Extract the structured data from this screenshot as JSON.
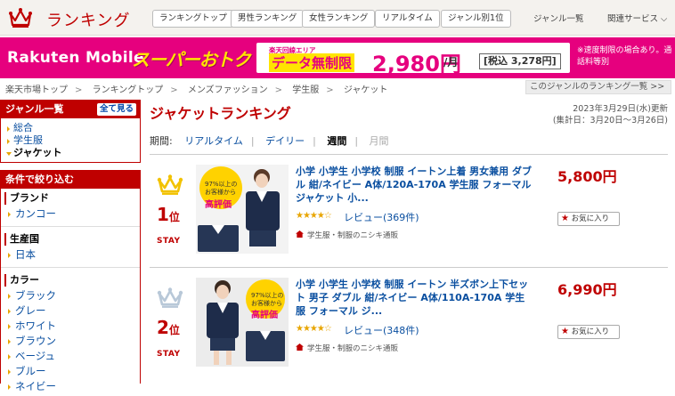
{
  "header": {
    "logo_text": "ランキング",
    "nav": [
      "ランキングトップ",
      "男性ランキング",
      "女性ランキング",
      "リアルタイム",
      "ジャンル別1位"
    ],
    "genre_list": "ジャンル一覧",
    "related": "関連サービス ⌵"
  },
  "banner": {
    "brand": "Rakuten Mobile",
    "super": "スーパーおトク",
    "small": "楽天回線エリア",
    "main": "データ無制限",
    "price": "2,980円",
    "unit": "/月",
    "tax": "[税込 3,278円]",
    "note": "※速度制限の場合あり。通話料等別",
    "bg": "#e6007e"
  },
  "breadcrumb": [
    "楽天市場トップ",
    "ランキングトップ",
    "メンズファッション",
    "学生服",
    "ジャケット"
  ],
  "genre_all_link": "このジャンルのランキング一覧 >>",
  "sidebar": {
    "genre_title": "ジャンル一覧",
    "see_all": "全て見る",
    "genres": [
      "総合",
      "学生服",
      "ジャケット"
    ],
    "filter_title": "条件で絞り込む",
    "groups": [
      {
        "title": "ブランド",
        "items": [
          "カンコー"
        ]
      },
      {
        "title": "生産国",
        "items": [
          "日本"
        ]
      },
      {
        "title": "カラー",
        "items": [
          "ブラック",
          "グレー",
          "ホワイト",
          "ブラウン",
          "ベージュ",
          "ブルー",
          "ネイビー"
        ]
      }
    ]
  },
  "main": {
    "title": "ジャケットランキング",
    "updated": "2023年3月29日(水)更新",
    "period_range": "(集計日：3月20日～3月26日)",
    "period_label": "期間:",
    "periods": [
      "リアルタイム",
      "デイリー",
      "週間",
      "月間"
    ]
  },
  "items": [
    {
      "rank": "1",
      "rank_suffix": "位",
      "stay": "STAY",
      "name": "小学 小学生 小学校 制服 イートン上着 男女兼用 ダブル 紺/ネイビー A体/120A-170A 学生服 フォーマル ジャケット 小...",
      "stars": "★★★★☆",
      "review": "レビュー(369件)",
      "shop": "学生服・制服のニシキ通販",
      "price": "5,800円",
      "fav": "お気に入り",
      "crown_color": "#f2c200",
      "thumb_badge_top": "97%以上の",
      "thumb_badge_mid": "お客様から",
      "thumb_badge_bot": "高評価"
    },
    {
      "rank": "2",
      "rank_suffix": "位",
      "stay": "STAY",
      "name": "小学 小学生 小学校 制服 イートン 半ズボン上下セット 男子 ダブル 紺/ネイビー A体/110A-170A 学生服 フォーマル ジ...",
      "stars": "★★★★☆",
      "review": "レビュー(348件)",
      "shop": "学生服・制服のニシキ通販",
      "price": "6,990円",
      "fav": "お気に入り",
      "crown_color": "#b8c8d8",
      "thumb_badge_top": "97%以上の",
      "thumb_badge_mid": "お客様から",
      "thumb_badge_bot": "高評価"
    }
  ]
}
